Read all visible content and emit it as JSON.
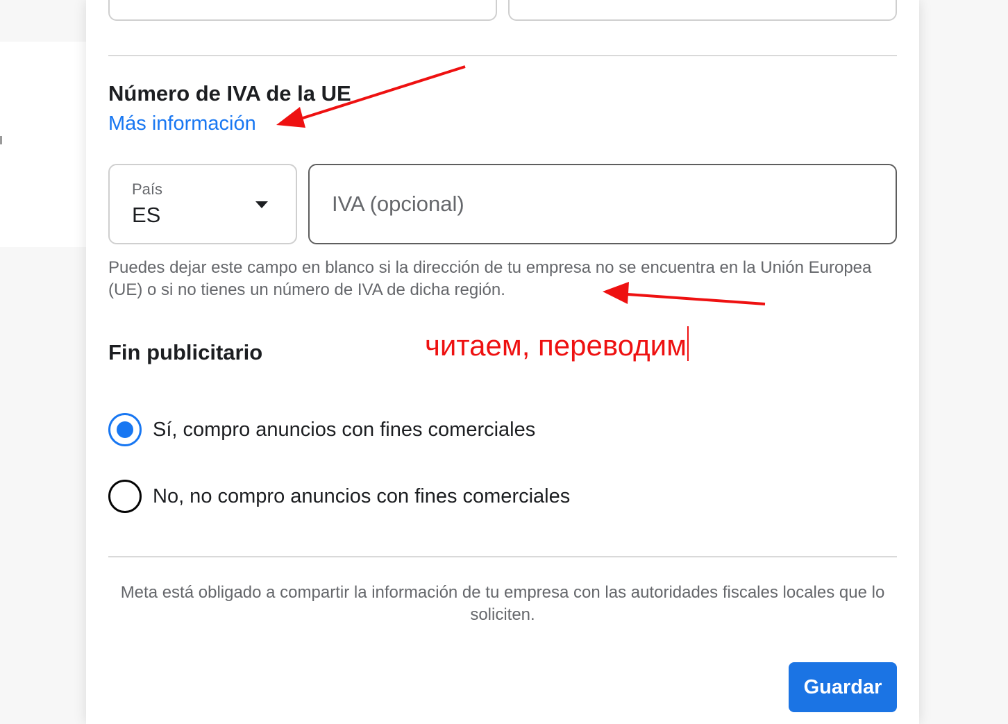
{
  "vat_section": {
    "title": "Número de IVA de la UE",
    "more_info_link": "Más información",
    "country_label": "País",
    "country_value": "ES",
    "vat_placeholder": "IVA (opcional)",
    "helper_text": "Puedes dejar este campo en blanco si la dirección de tu empresa no se encuentra en la Unión Europea (UE) o si no tienes un número de IVA de dicha región."
  },
  "annotation": {
    "text": "читаем, переводим",
    "color": "#ee1111"
  },
  "purpose_section": {
    "title": "Fin publicitario",
    "options": [
      {
        "label": "Sí, compro anuncios con fines comerciales",
        "selected": true
      },
      {
        "label": "No, no compro anuncios con fines comerciales",
        "selected": false
      }
    ]
  },
  "footer": {
    "note": "Meta está obligado a compartir la información de tu empresa con las autoridades fiscales locales que lo soliciten.",
    "save_label": "Guardar"
  },
  "colors": {
    "accent": "#1877f2",
    "button": "#1b74e4",
    "annotation": "#ee1111"
  }
}
